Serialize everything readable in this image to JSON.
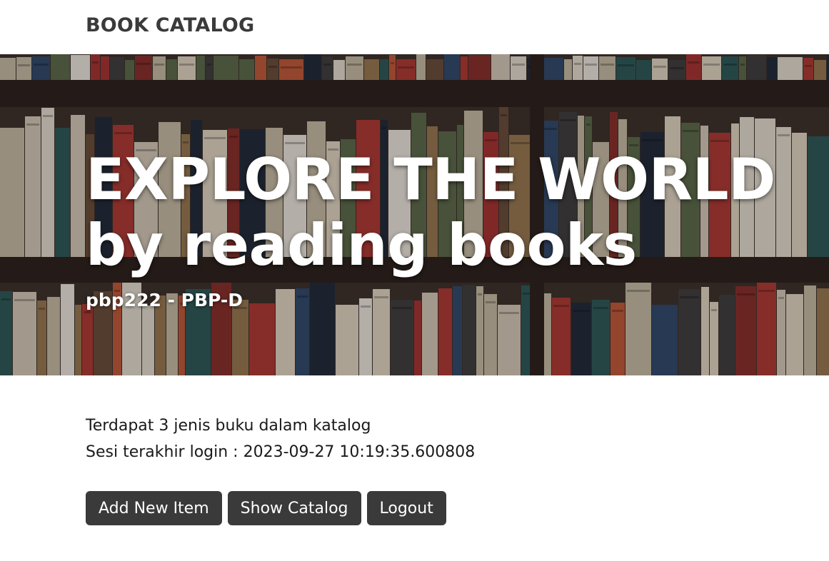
{
  "navbar": {
    "brand": "BOOK CATALOG"
  },
  "hero": {
    "title_line1": "EXPLORE THE WORLD",
    "title_line2": "by reading books",
    "subtitle": "pbp222 - PBP-D"
  },
  "info": {
    "book_count_text": "Terdapat 3 jenis buku dalam katalog",
    "last_login_text": "Sesi terakhir login : 2023-09-27 10:19:35.600808"
  },
  "actions": {
    "add_label": "Add New Item",
    "show_label": "Show Catalog",
    "logout_label": "Logout"
  },
  "colors": {
    "button_bg": "#3a3a3a",
    "brand_text": "#3a3a3a",
    "shelf_wood": "#3b302a"
  }
}
